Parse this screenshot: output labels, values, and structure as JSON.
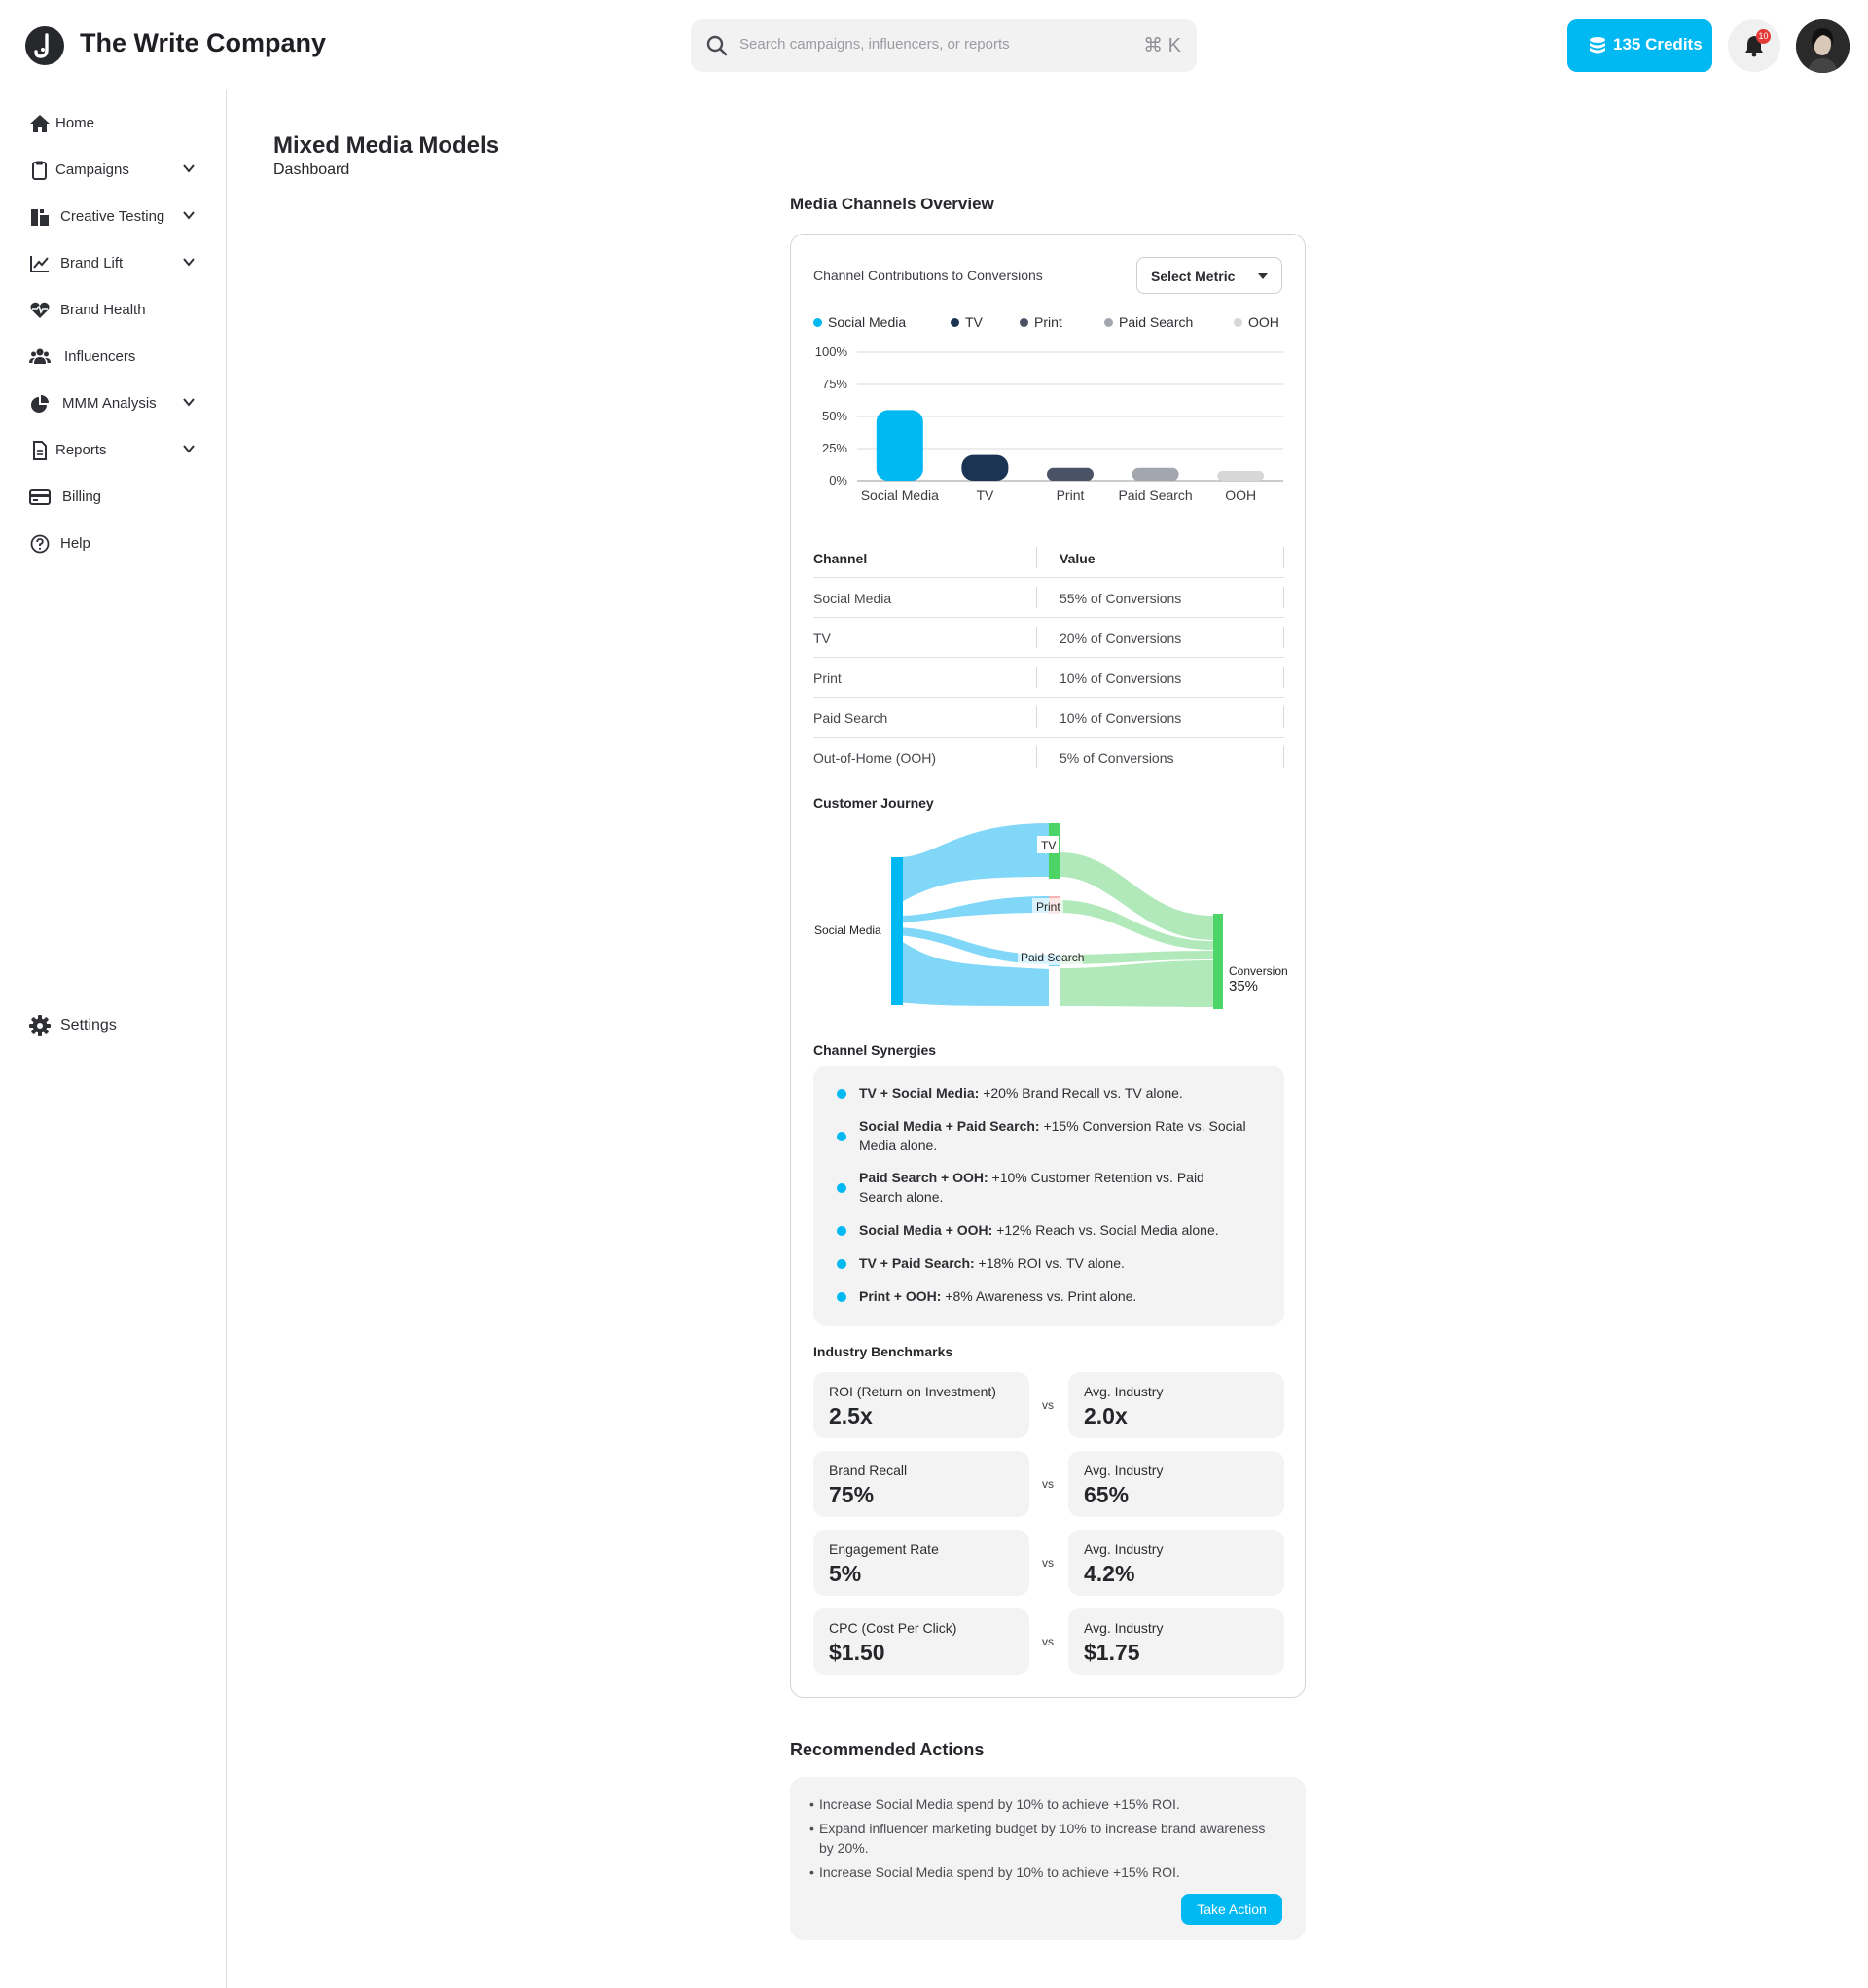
{
  "app": {
    "title": "The Write Company"
  },
  "header": {
    "search_placeholder": "Search campaigns, influencers, or reports",
    "shortcut": "⌘ K",
    "credits_label": "135 Credits",
    "notification_count": "10"
  },
  "sidebar": {
    "items": [
      {
        "label": "Home",
        "icon": "home-icon",
        "has_chevron": false
      },
      {
        "label": "Campaigns",
        "icon": "clipboard-icon",
        "has_chevron": true
      },
      {
        "label": "Creative Testing",
        "icon": "creative-testing-icon",
        "has_chevron": true
      },
      {
        "label": "Brand Lift",
        "icon": "line-chart-icon",
        "has_chevron": true
      },
      {
        "label": "Brand Health",
        "icon": "heart-pulse-icon",
        "has_chevron": false
      },
      {
        "label": "Influencers",
        "icon": "users-icon",
        "has_chevron": false
      },
      {
        "label": "MMM Analysis",
        "icon": "pie-chart-icon",
        "has_chevron": true
      },
      {
        "label": "Reports",
        "icon": "document-icon",
        "has_chevron": true
      },
      {
        "label": "Billing",
        "icon": "credit-card-icon",
        "has_chevron": false
      },
      {
        "label": "Help",
        "icon": "help-circle-icon",
        "has_chevron": false
      }
    ],
    "settings_label": "Settings"
  },
  "page": {
    "title": "Mixed Media Models",
    "subtitle": "Dashboard",
    "section_title": "Media Channels Overview"
  },
  "overview": {
    "card_title": "Channel Contributions to Conversions",
    "select_label": "Select Metric",
    "legend": [
      {
        "name": "Social Media",
        "color": "#00b8f2"
      },
      {
        "name": "TV",
        "color": "#1b3454"
      },
      {
        "name": "Print",
        "color": "#4a5265"
      },
      {
        "name": "Paid Search",
        "color": "#a3a6ae"
      },
      {
        "name": "OOH",
        "color": "#d7d7d7"
      }
    ],
    "table": {
      "headers": [
        "Channel",
        "Value"
      ],
      "rows": [
        [
          "Social Media",
          "55% of Conversions"
        ],
        [
          "TV",
          "20% of Conversions"
        ],
        [
          "Print",
          "10% of Conversions"
        ],
        [
          "Paid Search",
          "10% of Conversions"
        ],
        [
          "Out-of-Home (OOH)",
          "5% of Conversions"
        ]
      ]
    },
    "journey_title": "Customer Journey",
    "sankey_labels": {
      "source": "Social Media",
      "tv": "TV",
      "print": "Print",
      "paid_search": "Paid Search",
      "target": "Conversion",
      "target_value": "35%"
    },
    "synergies_title": "Channel Synergies",
    "synergies": [
      {
        "pair": "TV + Social Media:",
        "text": " +20% Brand Recall vs. TV alone."
      },
      {
        "pair": "Social Media + Paid Search:",
        "text": " +15% Conversion Rate vs. Social Media alone."
      },
      {
        "pair": "Paid Search + OOH:",
        "text": " +10% Customer Retention vs. Paid Search alone."
      },
      {
        "pair": "Social Media + OOH:",
        "text": " +12% Reach vs. Social Media alone."
      },
      {
        "pair": "TV + Paid Search:",
        "text": " +18% ROI vs. TV alone."
      },
      {
        "pair": "Print + OOH:",
        "text": " +8% Awareness vs. Print alone."
      }
    ],
    "benchmarks_title": "Industry Benchmarks",
    "vs_label": "vs",
    "benchmarks": [
      {
        "label": "ROI (Return on Investment)",
        "value": "2.5x",
        "industry_label": "Avg. Industry",
        "industry_value": "2.0x"
      },
      {
        "label": "Brand Recall",
        "value": "75%",
        "industry_label": "Avg. Industry",
        "industry_value": "65%"
      },
      {
        "label": "Engagement Rate",
        "value": "5%",
        "industry_label": "Avg. Industry",
        "industry_value": "4.2%"
      },
      {
        "label": "CPC (Cost Per Click)",
        "value": "$1.50",
        "industry_label": "Avg. Industry",
        "industry_value": "$1.75"
      }
    ]
  },
  "recommended": {
    "title": "Recommended Actions",
    "items": [
      "Increase Social Media spend by 10% to achieve +15% ROI.",
      "Expand influencer marketing budget by 10% to increase brand awareness by 20%.",
      "Increase Social Media spend by 10% to achieve +15% ROI."
    ],
    "button_label": "Take Action"
  },
  "chart_data": {
    "type": "bar",
    "categories": [
      "Social Media",
      "TV",
      "Print",
      "Paid Search",
      "OOH"
    ],
    "values": [
      55,
      20,
      10,
      10,
      5
    ],
    "colors": [
      "#00b8f2",
      "#1b3454",
      "#4a5265",
      "#a3a6ae",
      "#d7d7d7"
    ],
    "yticks": [
      "0%",
      "25%",
      "50%",
      "75%",
      "100%"
    ],
    "ylim": [
      0,
      100
    ],
    "grid": true,
    "legend": "top"
  }
}
